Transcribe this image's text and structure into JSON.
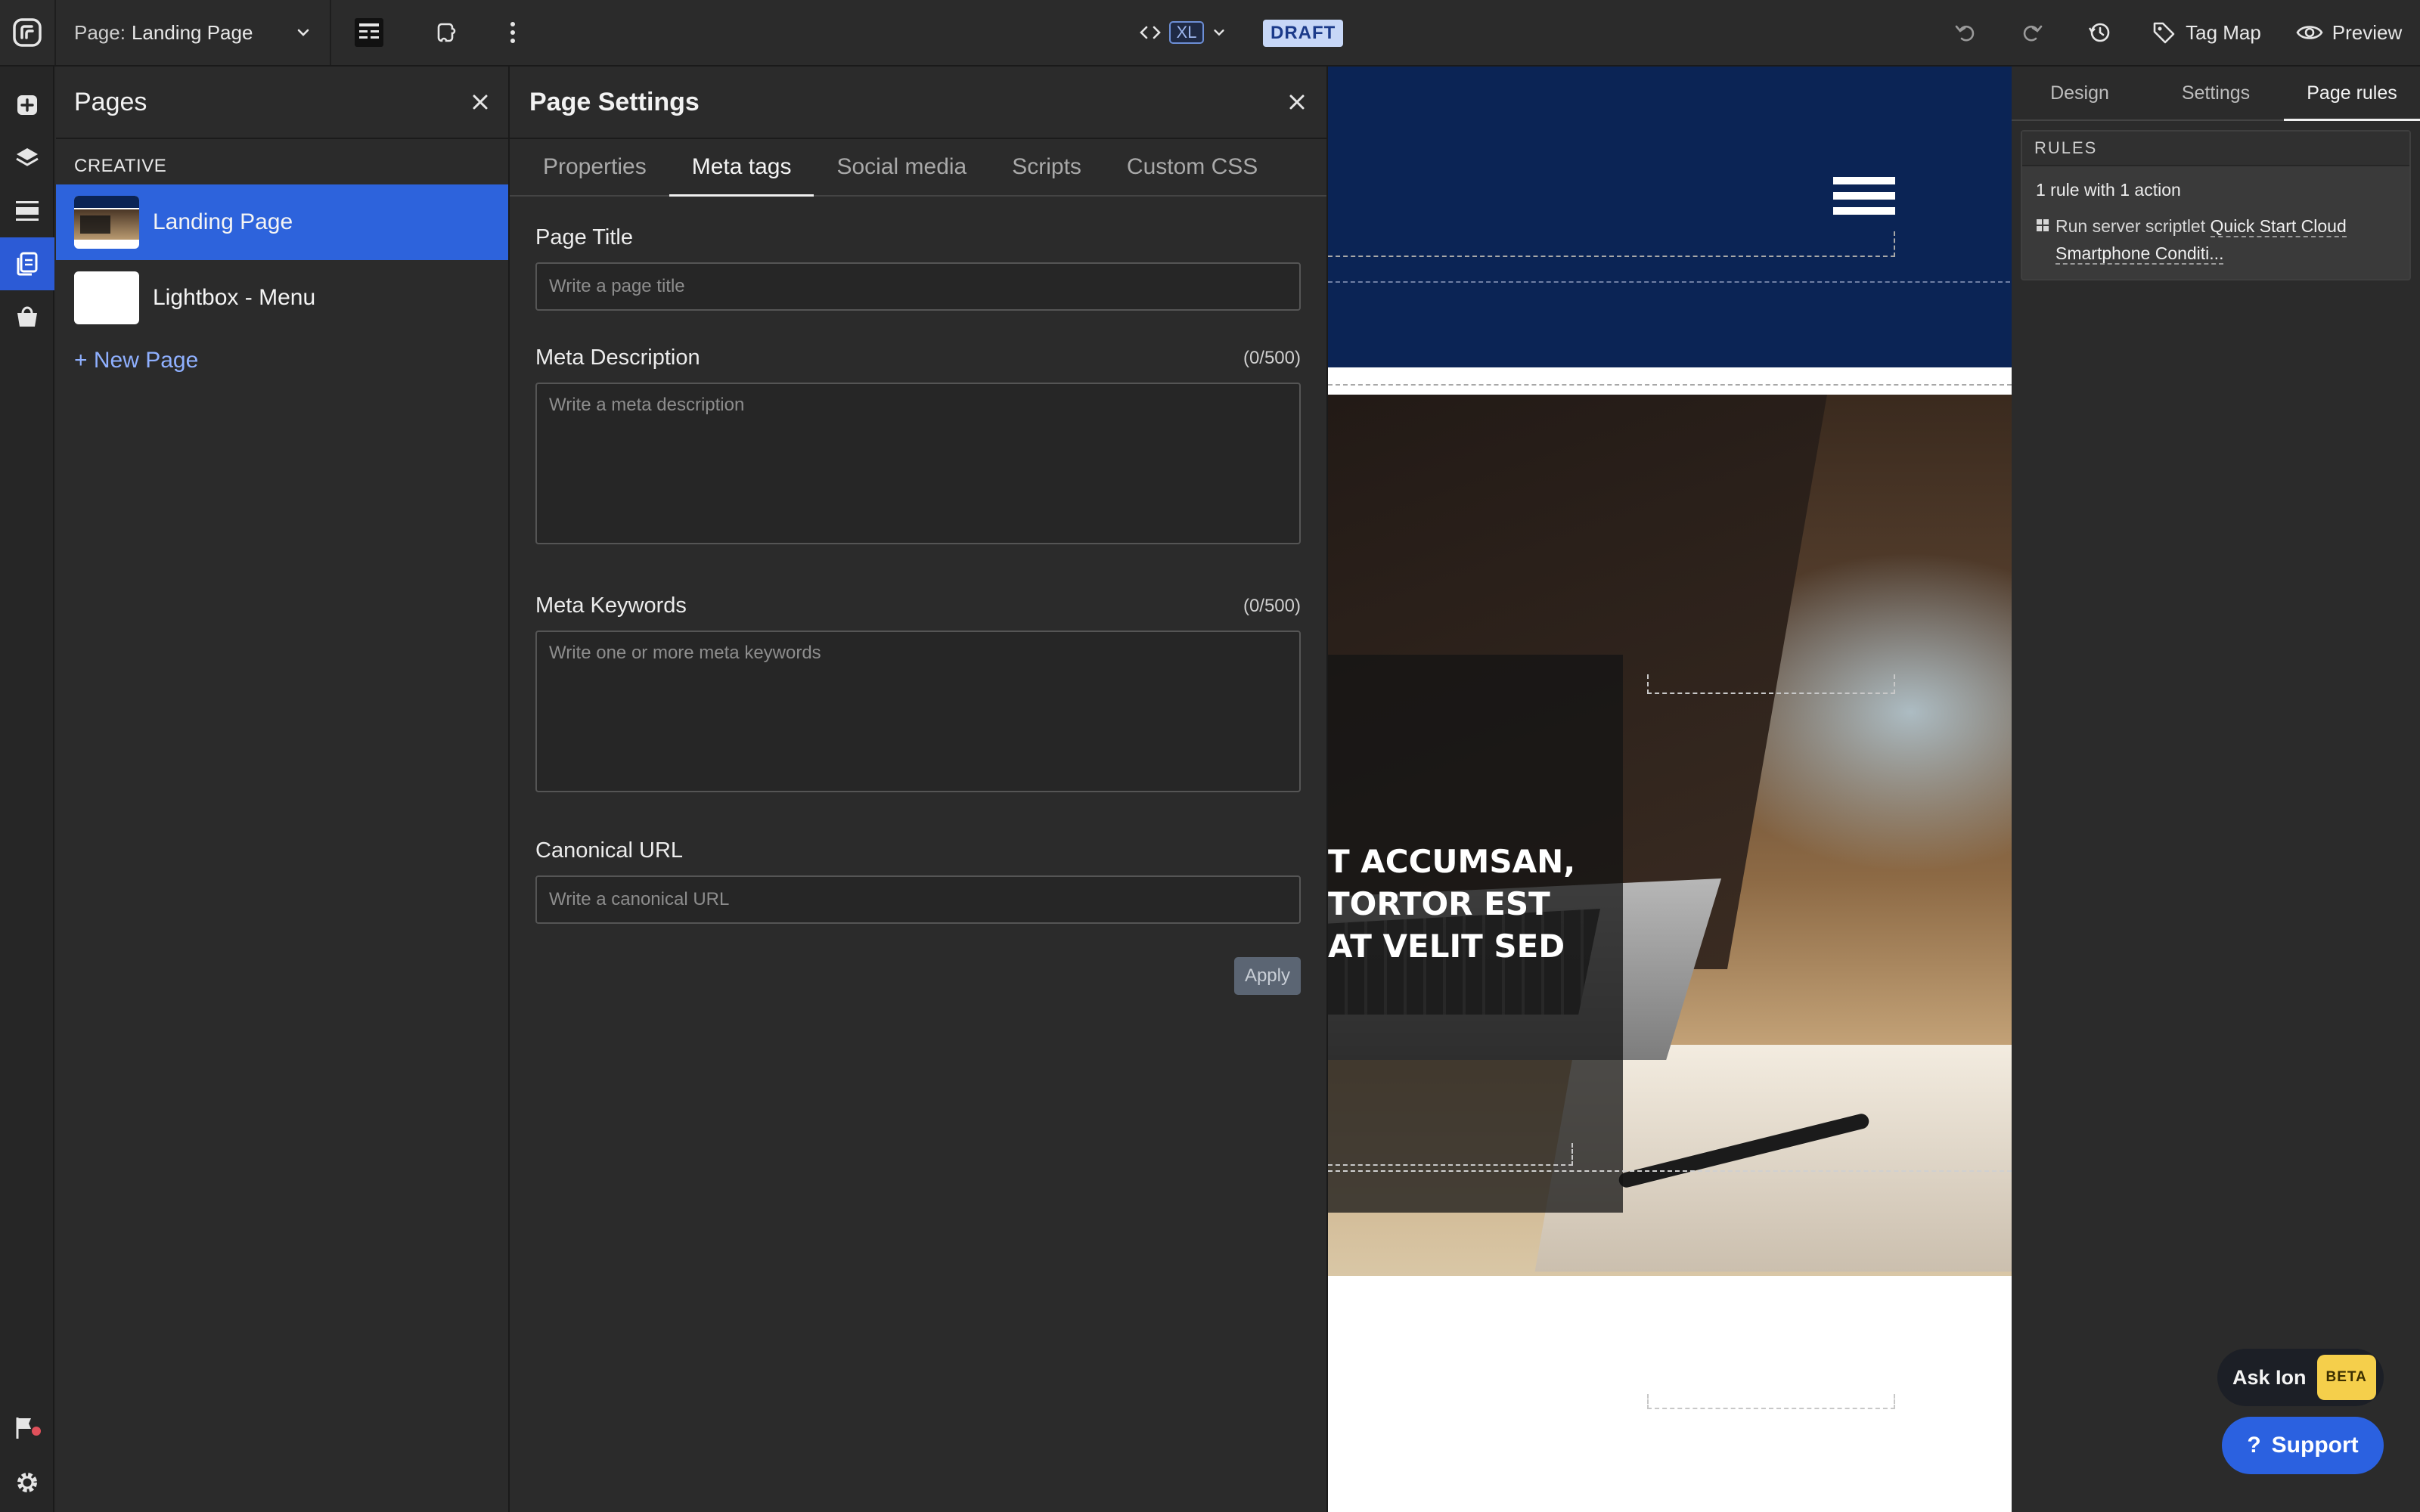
{
  "topbar": {
    "page_label": "Page:",
    "page_name": "Landing Page",
    "breakpoint": "XL",
    "status_badge": "DRAFT",
    "tag_map_label": "Tag Map",
    "preview_label": "Preview",
    "icons": [
      "logo-icon",
      "chevron-down-icon",
      "layout-icon",
      "plugin-icon",
      "more-vertical-icon",
      "code-icon",
      "undo-icon",
      "redo-icon",
      "history-icon",
      "tag-icon",
      "eye-icon"
    ]
  },
  "rail": {
    "items": [
      {
        "icon": "add-element-icon",
        "active": false
      },
      {
        "icon": "layers-icon",
        "active": false
      },
      {
        "icon": "sections-icon",
        "active": false
      },
      {
        "icon": "pages-icon",
        "active": true
      },
      {
        "icon": "store-icon",
        "active": false
      }
    ],
    "bottom": [
      {
        "icon": "flag-icon"
      },
      {
        "icon": "settings-gear-icon"
      }
    ]
  },
  "pages_panel": {
    "title": "Pages",
    "group_label": "CREATIVE",
    "pages": [
      {
        "name": "Landing Page",
        "selected": true
      },
      {
        "name": "Lightbox - Menu",
        "selected": false
      }
    ],
    "new_page_label": "+ New Page"
  },
  "settings_panel": {
    "title": "Page Settings",
    "tabs": [
      {
        "label": "Properties",
        "active": false
      },
      {
        "label": "Meta tags",
        "active": true
      },
      {
        "label": "Social media",
        "active": false
      },
      {
        "label": "Scripts",
        "active": false
      },
      {
        "label": "Custom CSS",
        "active": false
      }
    ],
    "fields": {
      "page_title": {
        "label": "Page Title",
        "placeholder": "Write a page title",
        "value": ""
      },
      "meta_description": {
        "label": "Meta Description",
        "counter": "(0/500)",
        "placeholder": "Write a meta description",
        "value": ""
      },
      "meta_keywords": {
        "label": "Meta Keywords",
        "counter": "(0/500)",
        "placeholder": "Write one or more meta keywords",
        "value": ""
      },
      "canonical_url": {
        "label": "Canonical URL",
        "placeholder": "Write a canonical URL",
        "value": ""
      }
    },
    "apply_label": "Apply"
  },
  "canvas": {
    "nav_color": "#0b2455",
    "hero_lines": [
      "T ACCUMSAN,",
      "TORTOR EST",
      "AT VELIT SED"
    ]
  },
  "right_panel": {
    "tabs": [
      {
        "label": "Design",
        "active": false
      },
      {
        "label": "Settings",
        "active": false
      },
      {
        "label": "Page rules",
        "active": true
      }
    ],
    "rules_header": "RULES",
    "rules_count": "1 rule with 1 action",
    "action_prefix": "Run server scriptlet",
    "action_link": "Quick Start Cloud Smartphone Conditi..."
  },
  "floating": {
    "ask_ion_label": "Ask Ion",
    "beta_label": "BETA",
    "support_label": "Support",
    "support_icon_glyph": "?"
  },
  "colors": {
    "accent": "#2d63dc",
    "draft_badge_bg": "#c7d7f7",
    "beta_bg": "#f5cf4b"
  }
}
